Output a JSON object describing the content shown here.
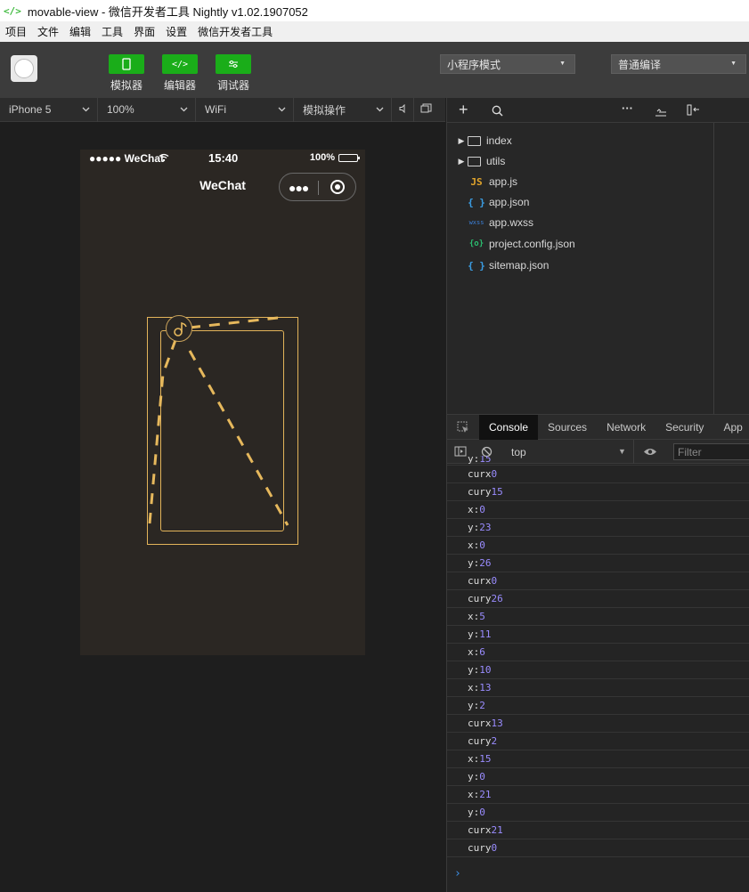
{
  "window": {
    "title": "movable-view - 微信开发者工具 Nightly v1.02.1907052",
    "icon": "code-icon"
  },
  "menu": [
    "项目",
    "文件",
    "编辑",
    "工具",
    "界面",
    "设置",
    "微信开发者工具"
  ],
  "toolbar": {
    "simulator": "模拟器",
    "editor": "编辑器",
    "debugger": "调试器",
    "mode_select": "小程序模式",
    "compile_select": "普通编译"
  },
  "device_bar": {
    "device": "iPhone 5",
    "zoom": "100%",
    "network": "WiFi",
    "simulate": "模拟操作"
  },
  "phone": {
    "carrier": "●●●●● WeChat",
    "time": "15:40",
    "battery": "100%",
    "battery_level": 1.0,
    "nav_title": "WeChat"
  },
  "explorer": {
    "files": [
      {
        "name": "index",
        "type": "folder"
      },
      {
        "name": "utils",
        "type": "folder"
      },
      {
        "name": "app.js",
        "type": "js",
        "icon": "JS",
        "color": "#e2a52b"
      },
      {
        "name": "app.json",
        "type": "json",
        "icon": "{ }",
        "color": "#3b9fe6"
      },
      {
        "name": "app.wxss",
        "type": "wxss",
        "icon": "wxss",
        "color": "#3b7fd6"
      },
      {
        "name": "project.config.json",
        "type": "config",
        "icon": "{o}",
        "color": "#2bbd6f"
      },
      {
        "name": "sitemap.json",
        "type": "json",
        "icon": "{ }",
        "color": "#3b9fe6"
      }
    ]
  },
  "devtools": {
    "tabs": [
      "Console",
      "Sources",
      "Network",
      "Security",
      "App"
    ],
    "active_tab": "Console",
    "context": "top",
    "filter_placeholder": "Filter"
  },
  "console_log": [
    {
      "key": "y:",
      "value": "15"
    },
    {
      "key": "curx",
      "value": "0"
    },
    {
      "key": "cury",
      "value": "15"
    },
    {
      "key": "x:",
      "value": "0"
    },
    {
      "key": "y:",
      "value": "23"
    },
    {
      "key": "x:",
      "value": "0"
    },
    {
      "key": "y:",
      "value": "26"
    },
    {
      "key": "curx",
      "value": "0"
    },
    {
      "key": "cury",
      "value": "26"
    },
    {
      "key": "x:",
      "value": "5"
    },
    {
      "key": "y:",
      "value": "11"
    },
    {
      "key": "x:",
      "value": "6"
    },
    {
      "key": "y:",
      "value": "10"
    },
    {
      "key": "x:",
      "value": "13"
    },
    {
      "key": "y:",
      "value": "2"
    },
    {
      "key": "curx",
      "value": "13"
    },
    {
      "key": "cury",
      "value": "2"
    },
    {
      "key": "x:",
      "value": "15"
    },
    {
      "key": "y:",
      "value": "0"
    },
    {
      "key": "x:",
      "value": "21"
    },
    {
      "key": "y:",
      "value": "0"
    },
    {
      "key": "curx",
      "value": "21"
    },
    {
      "key": "cury",
      "value": "0"
    }
  ],
  "colors": {
    "accent": "#1aad19",
    "outline": "#e3b45a",
    "log_number": "#9a8cff"
  }
}
